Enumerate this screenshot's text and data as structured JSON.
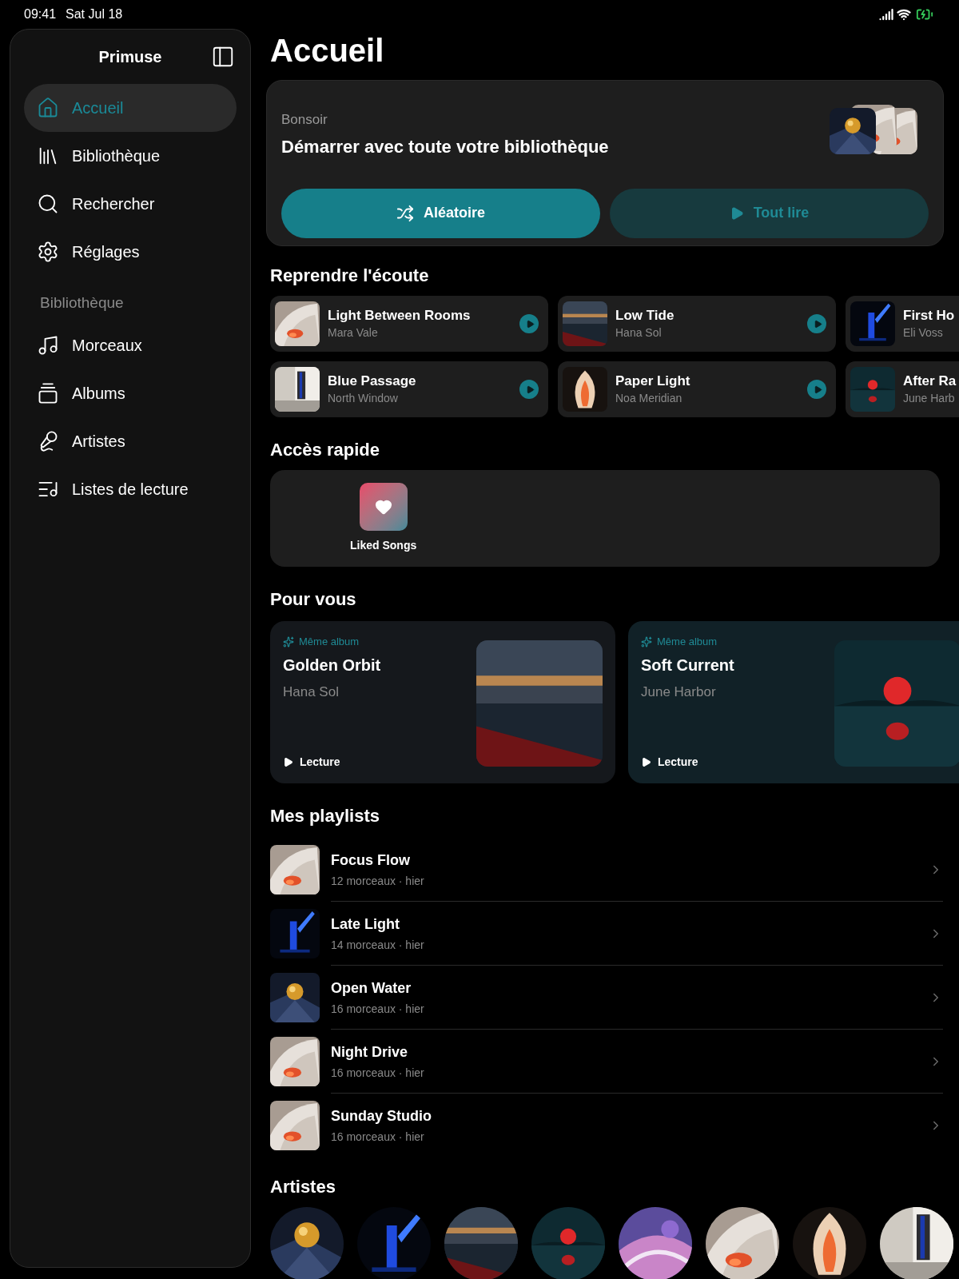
{
  "status_bar": {
    "time": "09:41",
    "date": "Sat Jul 18"
  },
  "sidebar": {
    "title": "Primuse",
    "items": [
      {
        "label": "Accueil",
        "kind": "home",
        "selected": true
      },
      {
        "label": "Bibliothèque",
        "kind": "library",
        "selected": false
      },
      {
        "label": "Rechercher",
        "kind": "search",
        "selected": false
      },
      {
        "label": "Réglages",
        "kind": "settings",
        "selected": false
      }
    ],
    "section": "Bibliothèque",
    "library_items": [
      {
        "label": "Morceaux",
        "kind": "note",
        "selected": false
      },
      {
        "label": "Albums",
        "kind": "albums",
        "selected": false
      },
      {
        "label": "Artistes",
        "kind": "mic",
        "selected": false
      },
      {
        "label": "Listes de lecture",
        "kind": "playlist",
        "selected": false
      }
    ]
  },
  "page_title": "Accueil",
  "hero": {
    "greeting": "Bonsoir",
    "headline": "Démarrer avec toute votre bibliothèque",
    "buttons": [
      {
        "label": "Aléatoire",
        "kind": "shuffle",
        "primary": true
      },
      {
        "label": "Tout lire",
        "kind": "play",
        "primary": false
      }
    ]
  },
  "resume": {
    "title": "Reprendre l'écoute",
    "items": [
      {
        "title": "Light Between Rooms",
        "artist": "Mara Vale"
      },
      {
        "title": "Low Tide",
        "artist": "Hana Sol"
      },
      {
        "title": "First Ho",
        "artist": "Eli Voss"
      },
      {
        "title": "Blue Passage",
        "artist": "North Window"
      },
      {
        "title": "Paper Light",
        "artist": "Noa Meridian"
      },
      {
        "title": "After Ra",
        "artist": "June Harb"
      }
    ]
  },
  "quick_access": {
    "title": "Accès rapide",
    "items": [
      {
        "label": "Liked Songs"
      }
    ]
  },
  "for_you": {
    "title": "Pour vous",
    "items": [
      {
        "tag": "Même album",
        "title": "Golden Orbit",
        "artist": "Hana Sol",
        "action": "Lecture"
      },
      {
        "tag": "Même album",
        "title": "Soft Current",
        "artist": "June Harbor",
        "action": "Lecture"
      }
    ]
  },
  "playlists": {
    "title": "Mes playlists",
    "items": [
      {
        "title": "Focus Flow",
        "meta": "12 morceaux · hier"
      },
      {
        "title": "Late Light",
        "meta": "14 morceaux · hier"
      },
      {
        "title": "Open Water",
        "meta": "16 morceaux · hier"
      },
      {
        "title": "Night Drive",
        "meta": "16 morceaux · hier"
      },
      {
        "title": "Sunday Studio",
        "meta": "16 morceaux · hier"
      }
    ]
  },
  "artists": {
    "title": "Artistes"
  }
}
